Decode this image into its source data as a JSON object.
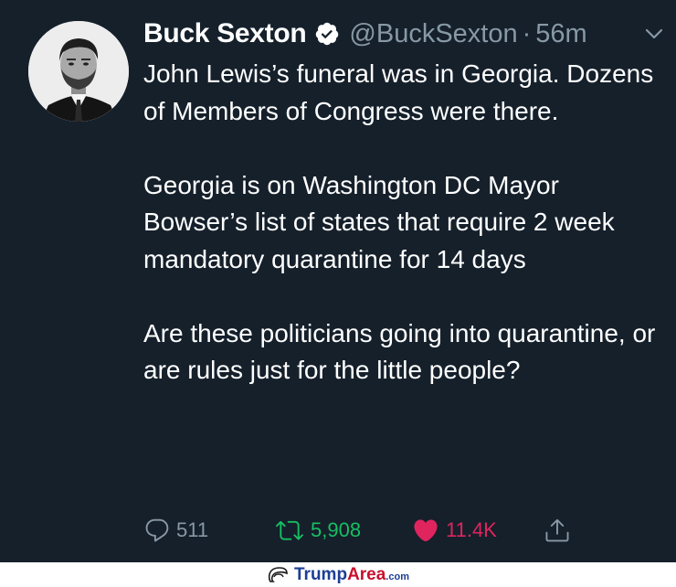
{
  "tweet": {
    "author_name": "Buck Sexton",
    "handle": "@BuckSexton",
    "separator": "·",
    "time": "56m",
    "paragraphs": [
      "John Lewis’s funeral was in Georgia. Dozens of Members of Congress were there.",
      "Georgia is on Washington DC Mayor Bowser’s list of states that require 2 week mandatory quarantine for 14 days",
      "Are these politicians going into quarantine, or are rules just for the little people?"
    ],
    "actions": {
      "replies": "511",
      "retweets": "5,908",
      "likes": "11.4K"
    },
    "icons": {
      "verified": "verified-badge-icon",
      "caret": "chevron-down-icon",
      "reply": "reply-icon",
      "retweet": "retweet-icon",
      "like": "heart-icon",
      "share": "share-icon"
    },
    "colors": {
      "background": "#15202b",
      "text": "#ffffff",
      "muted": "#8899a6",
      "retweet": "#17bf63",
      "like": "#e0245e"
    }
  },
  "watermark": {
    "part1": "Trump",
    "part2": "Area",
    "part3": ".com"
  }
}
